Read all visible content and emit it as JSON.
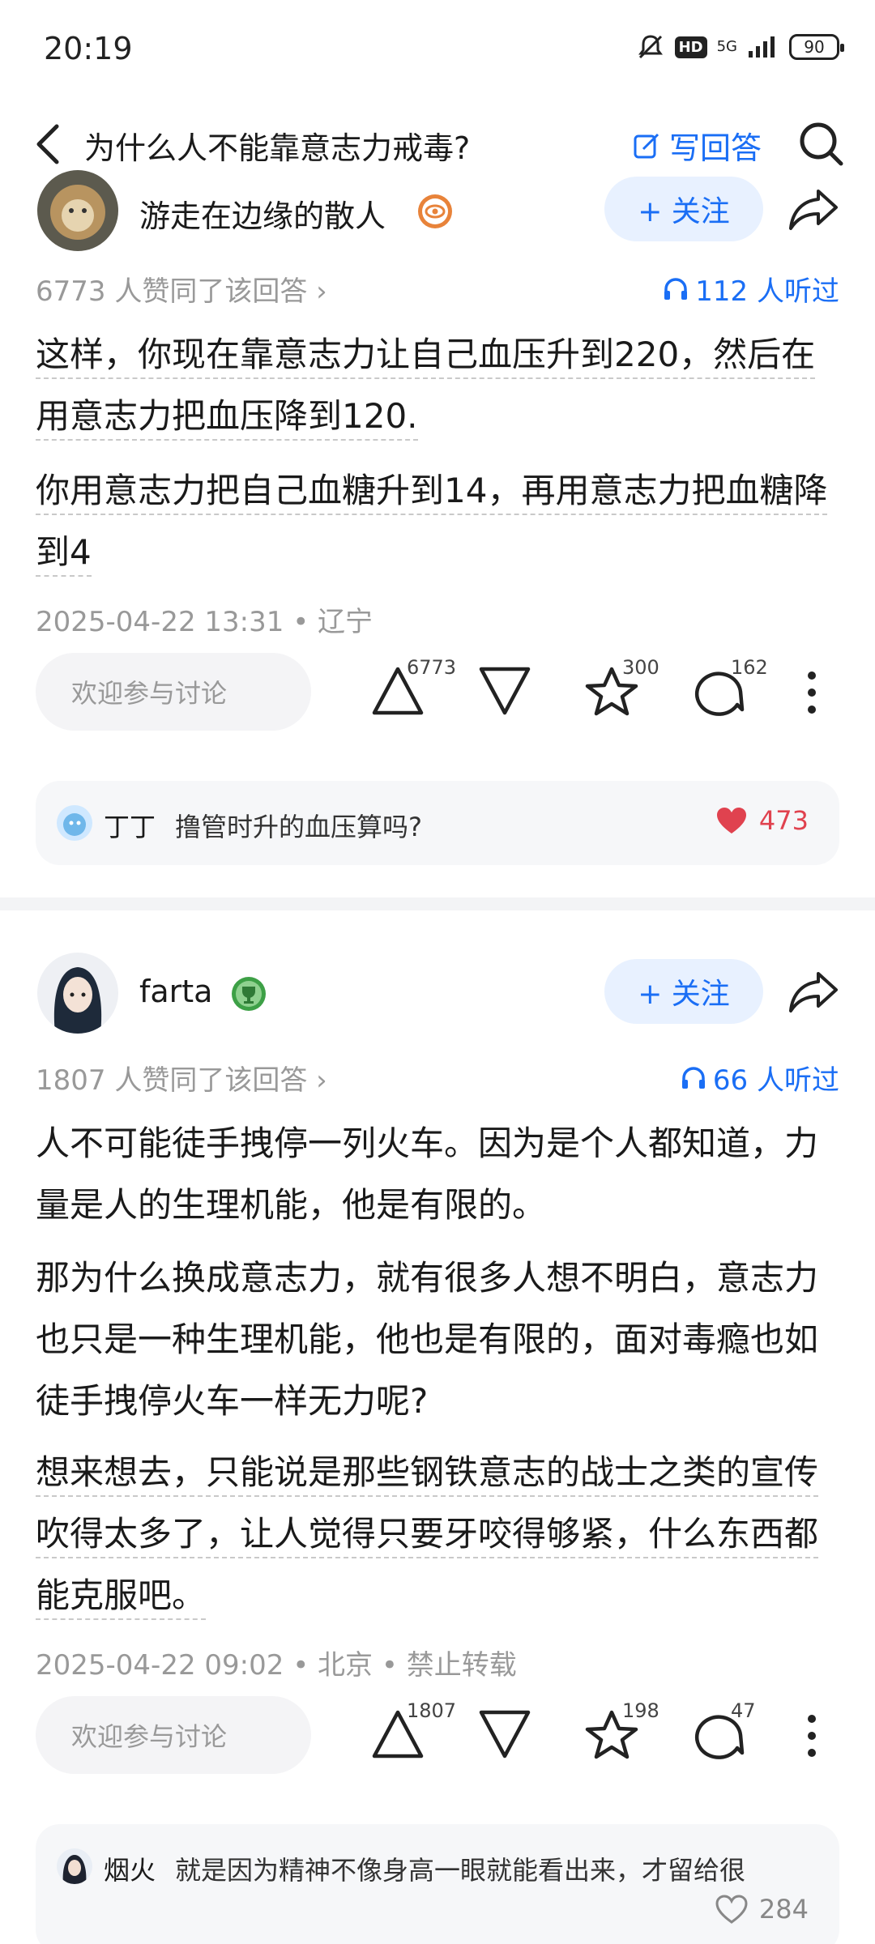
{
  "status": {
    "time": "20:19",
    "hd": "HD",
    "network": "5G",
    "battery": "90"
  },
  "nav": {
    "title": "为什么人不能靠意志力戒毒?",
    "write_label": "写回答"
  },
  "answers": [
    {
      "author": "游走在边缘的散人",
      "follow_label": "+ 关注",
      "upvote_note": "6773 人赞同了该回答 ›",
      "listened": "112 人听过",
      "paragraphs": [
        "这样，你现在靠意志力让自己血压升到220，然后在用意志力把血压降到120.",
        "你用意志力把自己血糖升到14，再用意志力把血糖降到4"
      ],
      "date_line": "2025-04-22 13:31 • 辽宁",
      "comment_placeholder": "欢迎参与讨论",
      "counts": {
        "up": "6773",
        "fav": "300",
        "comments": "162"
      },
      "hot_comment": {
        "name": "丁丁",
        "text": "撸管时升的血压算吗?",
        "likes": "473"
      }
    },
    {
      "author": "farta",
      "follow_label": "+ 关注",
      "upvote_note": "1807 人赞同了该回答 ›",
      "listened": "66 人听过",
      "paragraphs": [
        "人不可能徒手拽停一列火车。因为是个人都知道，力量是人的生理机能，他是有限的。",
        "那为什么换成意志力，就有很多人想不明白，意志力也只是一种生理机能，他也是有限的，面对毒瘾也如徒手拽停火车一样无力呢?",
        "想来想去，只能说是那些钢铁意志的战士之类的宣传吹得太多了，让人觉得只要牙咬得够紧，什么东西都能克服吧。"
      ],
      "date_line": "2025-04-22 09:02 • 北京 • 禁止转载",
      "comment_placeholder": "欢迎参与讨论",
      "counts": {
        "up": "1807",
        "fav": "198",
        "comments": "47"
      },
      "hot_comment": {
        "name": "烟火",
        "text": "就是因为精神不像身高一眼就能看出来，才留给很",
        "likes": "284"
      }
    }
  ],
  "colors": {
    "accent": "#1a6ef5",
    "muted": "#999999",
    "like_red": "#e0424f"
  }
}
